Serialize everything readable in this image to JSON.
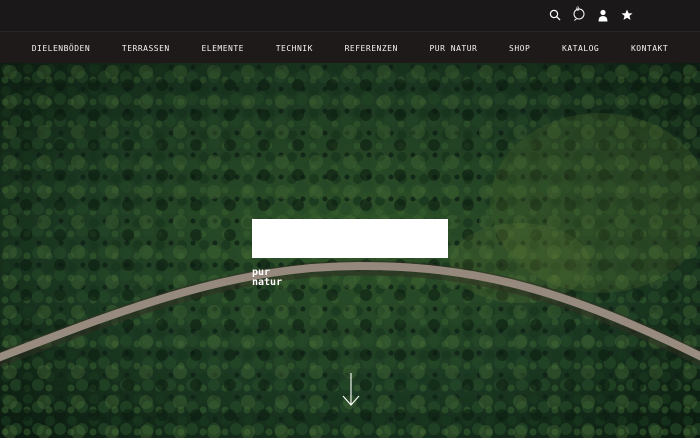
{
  "header": {
    "cart_count": "0",
    "icons": [
      "search-icon",
      "cart-icon",
      "user-icon",
      "star-icon"
    ]
  },
  "nav": {
    "items": [
      {
        "label": "DIELENBÖDEN"
      },
      {
        "label": "TERRASSEN"
      },
      {
        "label": "ELEMENTE"
      },
      {
        "label": "TECHNIK"
      },
      {
        "label": "REFERENZEN"
      },
      {
        "label": "PUR NATUR"
      },
      {
        "label": "SHOP"
      },
      {
        "label": "KATALOG"
      },
      {
        "label": "KONTAKT"
      }
    ]
  },
  "hero": {
    "logo_line1": "pur",
    "logo_line2": "natur",
    "scroll_icon": "arrow-down-icon"
  },
  "colors": {
    "topbar": "#1a1818",
    "forest_dark": "#0f2614",
    "forest_mid": "#2f5a2c",
    "road": "#b9a99a"
  }
}
